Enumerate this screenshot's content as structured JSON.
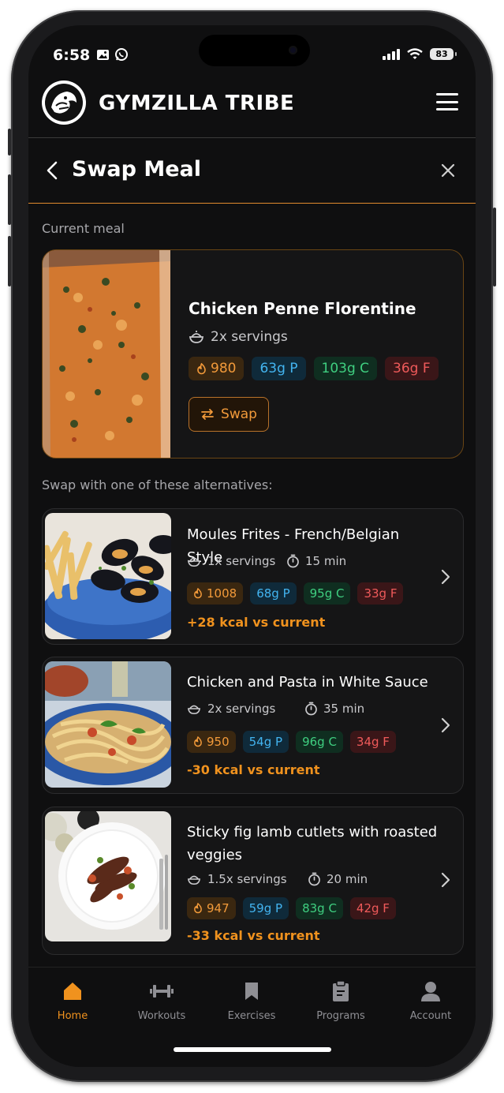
{
  "status": {
    "time": "6:58",
    "battery": "83"
  },
  "app": {
    "brand": "GYMZILLA TRIBE",
    "logo": "gorilla-logo"
  },
  "page": {
    "title": "Swap Meal"
  },
  "current": {
    "section_label": "Current meal",
    "name": "Chicken Penne Florentine",
    "servings": "2x servings",
    "kcal": "980",
    "protein": "63g P",
    "carbs": "103g C",
    "fat": "36g F",
    "swap_label": "Swap"
  },
  "alternatives_label": "Swap with one of these alternatives:",
  "alternatives": [
    {
      "name": "Moules Frites - French/Belgian Style",
      "servings": "1x servings",
      "time": "15 min",
      "kcal": "1008",
      "protein": "68g P",
      "carbs": "95g C",
      "fat": "33g F",
      "delta": "+28 kcal vs current"
    },
    {
      "name": "Chicken and Pasta in White Sauce",
      "servings": "2x servings",
      "time": "35 min",
      "kcal": "950",
      "protein": "54g P",
      "carbs": "96g C",
      "fat": "34g F",
      "delta": "-30 kcal vs current"
    },
    {
      "name": "Sticky fig lamb cutlets with roasted veggies",
      "servings": "1.5x servings",
      "time": "20 min",
      "kcal": "947",
      "protein": "59g P",
      "carbs": "83g C",
      "fat": "42g F",
      "delta": "-33 kcal vs current"
    }
  ],
  "nav": [
    {
      "label": "Home",
      "icon": "home-icon",
      "active": true
    },
    {
      "label": "Workouts",
      "icon": "dumbbell-icon"
    },
    {
      "label": "Exercises",
      "icon": "bookmark-icon"
    },
    {
      "label": "Programs",
      "icon": "clipboard-icon"
    },
    {
      "label": "Account",
      "icon": "user-icon"
    }
  ],
  "colors": {
    "accent": "#f0921e",
    "kcal": "#f29a3a",
    "protein": "#43b4f0",
    "carbs": "#3fcf80",
    "fat": "#ef5a5a",
    "background": "#0f0f10"
  }
}
